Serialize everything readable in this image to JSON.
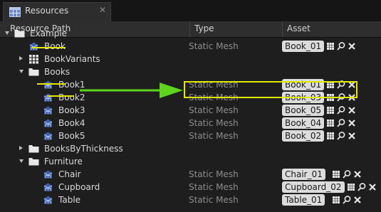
{
  "tab": {
    "title": "Resources",
    "icon": "table-icon",
    "close": "✕"
  },
  "columns": {
    "path": "Resource Path",
    "type": "Type",
    "asset": "Asset"
  },
  "rows": [
    {
      "name": "Example",
      "type": "",
      "asset": "",
      "kind": "folder",
      "expanded": true
    },
    {
      "name": "Book",
      "type": "Static Mesh",
      "asset": "Book_01",
      "kind": "mesh"
    },
    {
      "name": "BookVariants",
      "type": "",
      "asset": "",
      "kind": "grid",
      "expanded": false
    },
    {
      "name": "Books",
      "type": "",
      "asset": "",
      "kind": "folder",
      "expanded": true
    },
    {
      "name": "Book1",
      "type": "Static Mesh",
      "asset": "Book_01",
      "kind": "mesh"
    },
    {
      "name": "Book2",
      "type": "Static Mesh",
      "asset": "Book_03",
      "kind": "mesh"
    },
    {
      "name": "Book3",
      "type": "Static Mesh",
      "asset": "Book_05",
      "kind": "mesh"
    },
    {
      "name": "Book4",
      "type": "Static Mesh",
      "asset": "Book_04",
      "kind": "mesh"
    },
    {
      "name": "Book5",
      "type": "Static Mesh",
      "asset": "Book_02",
      "kind": "mesh"
    },
    {
      "name": "BooksByThickness",
      "type": "",
      "asset": "",
      "kind": "folder",
      "expanded": false
    },
    {
      "name": "Furniture",
      "type": "",
      "asset": "",
      "kind": "folder",
      "expanded": true
    },
    {
      "name": "Chair",
      "type": "Static Mesh",
      "asset": "Chair_01",
      "kind": "mesh"
    },
    {
      "name": "Cupboard",
      "type": "Static Mesh",
      "asset": "Cupboard_02",
      "kind": "mesh"
    },
    {
      "name": "Table",
      "type": "Static Mesh",
      "asset": "Table_01",
      "kind": "mesh"
    }
  ],
  "colors": {
    "highlight": "#e4e600",
    "arrow": "#5fd41c"
  }
}
